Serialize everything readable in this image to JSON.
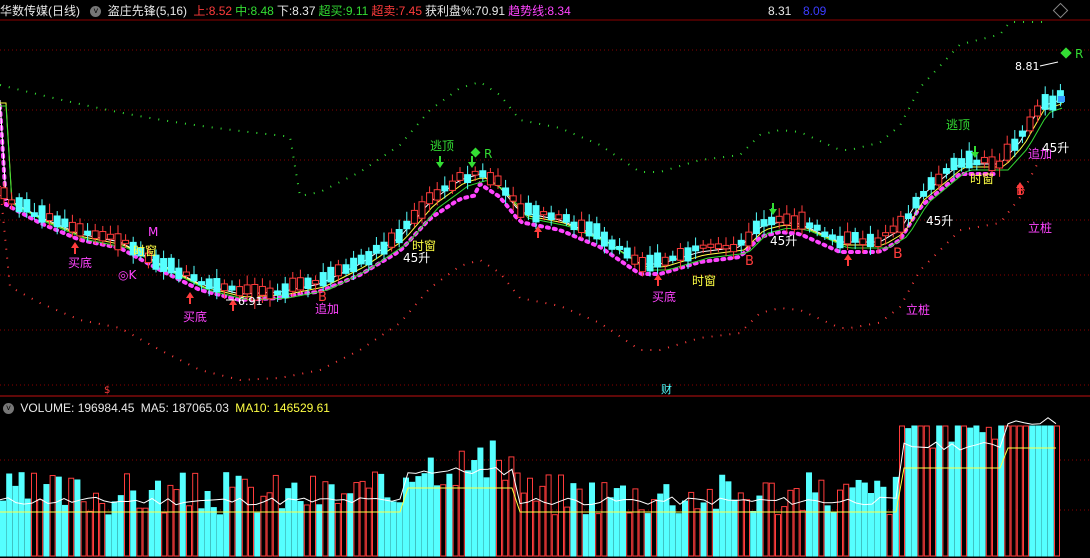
{
  "header": {
    "stock_name": "华数传媒(日线)",
    "indicator_name": "盗庄先锋",
    "indicator_params": "(5,16)",
    "items": [
      {
        "label": "上:",
        "value": "8.52",
        "color": "#ff3c3c"
      },
      {
        "label": "中:",
        "value": "8.48",
        "color": "#33dd33"
      },
      {
        "label": "下:",
        "value": "8.37",
        "color": "#e8e8e8"
      },
      {
        "label": "超买:",
        "value": "9.11",
        "color": "#33dd33"
      },
      {
        "label": "超卖:",
        "value": "7.45",
        "color": "#ff3c3c"
      },
      {
        "label": "获利盘%:",
        "value": "70.91",
        "color": "#e8e8e8"
      },
      {
        "label": "趋势线:",
        "value": "8.34",
        "color": "#ff44ff"
      }
    ],
    "right_value_1": "8.31",
    "right_value_2": "8.09"
  },
  "volume_header": {
    "volume_label": "VOLUME:",
    "volume_value": "196984.45",
    "ma5_label": "MA5:",
    "ma5_value": "187065.03",
    "ma10_label": "MA10:",
    "ma10_value": "146529.61"
  },
  "annotations": {
    "buy_bottom": "买底",
    "time_window": "时窗",
    "escape_top": "逃顶",
    "add_position": "追加",
    "rise_45": "45升",
    "set_pile": "立桩",
    "ok_mark": "◎K",
    "m_mark": "M",
    "r_mark": "R",
    "b_mark": "B",
    "low_price": "6.91",
    "high_price": "8.81",
    "cai_mark": "财",
    "dollar_mark": "$"
  },
  "colors": {
    "up": "#ff3c3c",
    "down": "#55ffff",
    "ma_white": "#ffffff",
    "ma_yellow": "#ffff44",
    "ma_green": "#33dd33",
    "trend_dots": "#ff44ff",
    "upper_band": "#33dd33",
    "lower_band": "#ff3c3c",
    "grid": "#8b0000"
  }
}
